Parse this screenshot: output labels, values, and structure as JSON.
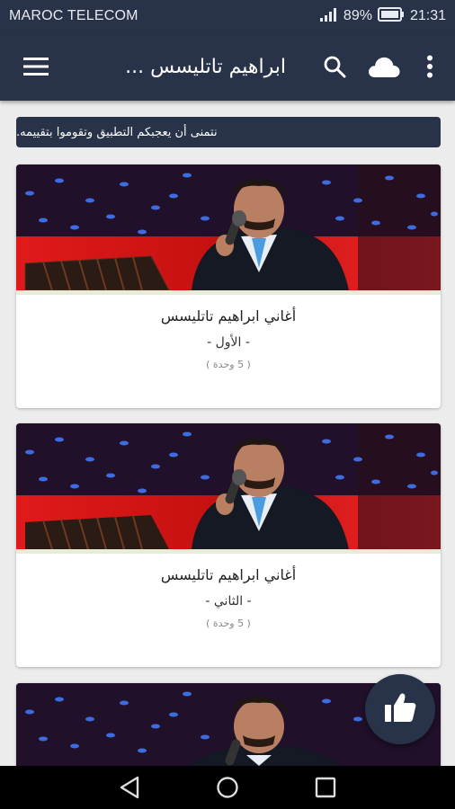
{
  "status_bar": {
    "carrier": "MAROC TELECOM",
    "battery": "89%",
    "time": "21:31"
  },
  "app_bar": {
    "title": "ابراهيم تاتليسس ..."
  },
  "banner": {
    "text": "نتمنى أن يعجبكم التطبيق وتقوموا بتقييمه."
  },
  "cards": [
    {
      "title": "أغاني ابراهيم تاتليسس",
      "subtitle": "- الأول -",
      "count": "( 5 وحدة )"
    },
    {
      "title": "أغاني ابراهيم تاتليسس",
      "subtitle": "- الثاني -",
      "count": "( 5 وحدة )"
    }
  ],
  "icons": {
    "menu": "hamburger-menu-icon",
    "search": "search-icon",
    "cloud": "cloud-icon",
    "more": "more-vert-icon",
    "fab": "thumbs-up-icon",
    "nav_back": "back-triangle-icon",
    "nav_home": "home-circle-icon",
    "nav_recents": "recents-square-icon"
  },
  "colors": {
    "primary": "#283249",
    "background": "#ececec",
    "card_divider": "#e8edd8"
  }
}
